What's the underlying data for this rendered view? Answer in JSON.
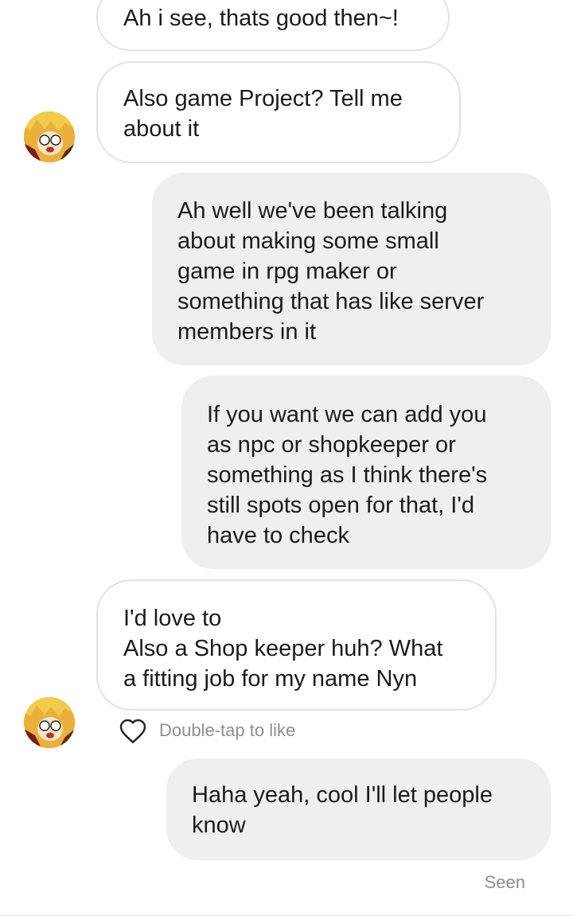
{
  "messages": [
    {
      "sender": "them",
      "text": "Ah i see, thats good then~!"
    },
    {
      "sender": "them",
      "text": "Also game Project? Tell me\nabout it"
    },
    {
      "sender": "me",
      "text": "Ah well we've been talking\nabout making some small\ngame in rpg maker or\nsomething that has like server\nmembers in it"
    },
    {
      "sender": "me",
      "text": "If you want we can add you\nas npc or shopkeeper or\nsomething as I think there's\nstill spots open for that, I'd\nhave to check"
    },
    {
      "sender": "them",
      "text": "I'd love to\nAlso a Shop keeper huh? What\na fitting job for my name Nyn"
    },
    {
      "sender": "me",
      "text": "Haha yeah, cool I'll let people\nknow"
    }
  ],
  "like_hint": {
    "icon": "heart-outline-icon",
    "label": "Double-tap to like"
  },
  "status": {
    "seen_label": "Seen"
  },
  "colors": {
    "incoming_bubble_bg": "#ffffff",
    "incoming_bubble_border": "#e3e3e3",
    "outgoing_bubble_bg": "#efefef",
    "meta_text": "#8e8e8e"
  }
}
